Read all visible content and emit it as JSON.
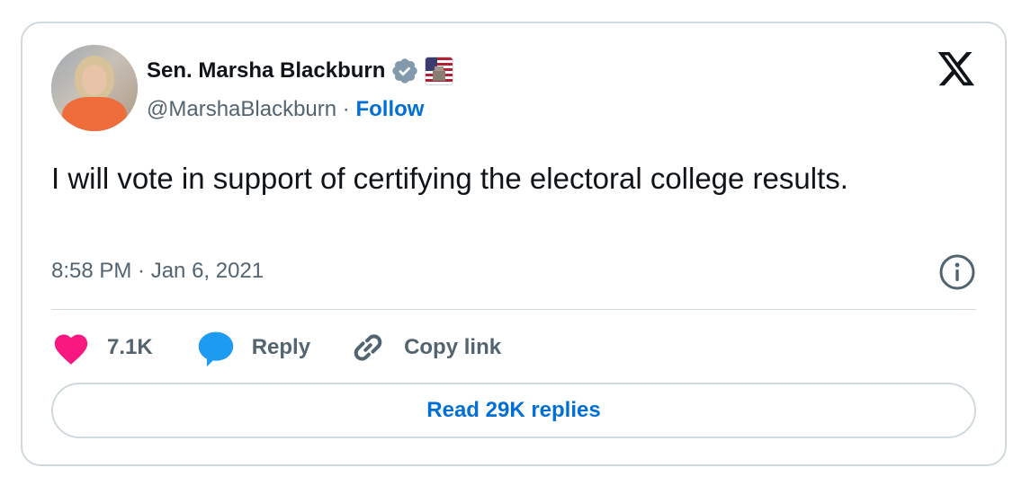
{
  "author": {
    "name": "Sen. Marsha Blackburn",
    "handle": "@MarshaBlackburn",
    "separator": " · ",
    "follow_label": "Follow"
  },
  "tweet": {
    "text": "I will vote in support of certifying the electoral college results.",
    "timestamp": "8:58 PM · Jan 6, 2021"
  },
  "actions": {
    "like_count": "7.1K",
    "reply_label": "Reply",
    "copy_label": "Copy link"
  },
  "read_replies_label": "Read 29K replies",
  "icons": {
    "brand": "x-logo-icon",
    "verified": "verified-badge-icon",
    "affiliation": "us-flag-badge-icon",
    "info": "info-icon",
    "like": "heart-icon",
    "reply": "speech-bubble-icon",
    "copy": "link-icon"
  },
  "colors": {
    "text": "#0f1419",
    "secondary": "#536471",
    "link": "#006fd6",
    "like": "#f91880",
    "reply": "#1d9bf0",
    "border": "#cfd9de",
    "verified": "#829aab"
  }
}
